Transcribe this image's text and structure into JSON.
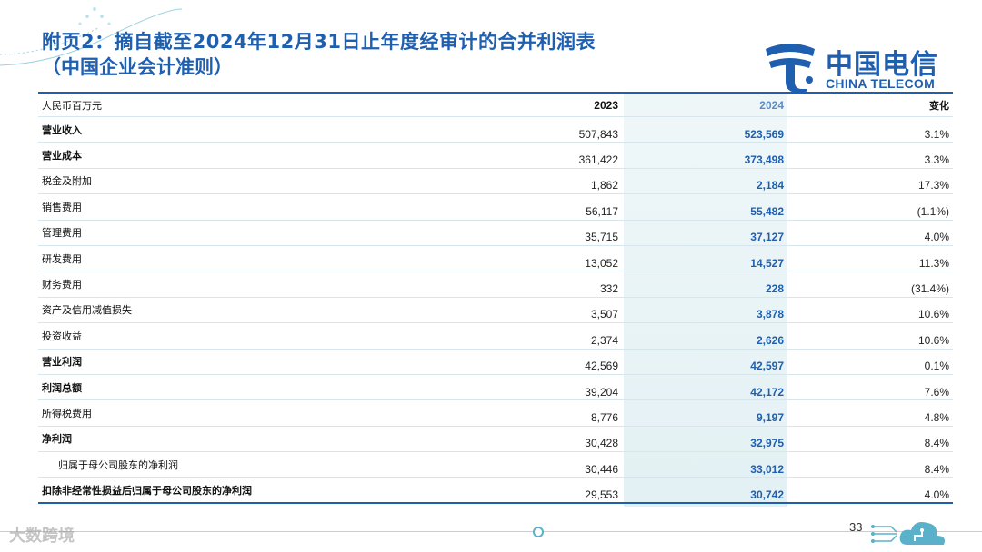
{
  "title_line1": "附页2：摘自截至2024年12月31日止年度经审计的合并利润表",
  "title_line2": "（中国企业会计准则）",
  "logo": {
    "cn": "中国电信",
    "en": "CHINA TELECOM",
    "color": "#1f5fb0"
  },
  "table": {
    "headers": {
      "label": "人民币百万元",
      "y2023": "2023",
      "y2024": "2024",
      "change": "变化"
    },
    "rows": [
      {
        "label": "营业收入",
        "y2023": "507,843",
        "y2024": "523,569",
        "change": "3.1%"
      },
      {
        "label": "营业成本",
        "y2023": "361,422",
        "y2024": "373,498",
        "change": "3.3%"
      },
      {
        "label": "税金及附加",
        "y2023": "1,862",
        "y2024": "2,184",
        "change": "17.3%"
      },
      {
        "label": "销售费用",
        "y2023": "56,117",
        "y2024": "55,482",
        "change": "(1.1%)"
      },
      {
        "label": "管理费用",
        "y2023": "35,715",
        "y2024": "37,127",
        "change": "4.0%"
      },
      {
        "label": "研发费用",
        "y2023": "13,052",
        "y2024": "14,527",
        "change": "11.3%"
      },
      {
        "label": "财务费用",
        "y2023": "332",
        "y2024": "228",
        "change": "(31.4%)"
      },
      {
        "label": "资产及信用减值损失",
        "y2023": "3,507",
        "y2024": "3,878",
        "change": "10.6%"
      },
      {
        "label": "投资收益",
        "y2023": "2,374",
        "y2024": "2,626",
        "change": "10.6%"
      },
      {
        "label": "营业利润",
        "y2023": "42,569",
        "y2024": "42,597",
        "change": "0.1%"
      },
      {
        "label": "利润总额",
        "y2023": "39,204",
        "y2024": "42,172",
        "change": "7.6%"
      },
      {
        "label": "所得税费用",
        "y2023": "8,776",
        "y2024": "9,197",
        "change": "4.8%"
      },
      {
        "label": "净利润",
        "y2023": "30,428",
        "y2024": "32,975",
        "change": "8.4%"
      },
      {
        "label": "归属于母公司股东的净利润",
        "y2023": "30,446",
        "y2024": "33,012",
        "change": "8.4%"
      },
      {
        "label": "扣除非经常性损益后归属于母公司股东的净利润",
        "y2023": "29,553",
        "y2024": "30,742",
        "change": "4.0%"
      }
    ]
  },
  "page_number": "33",
  "watermark": "大数跨境",
  "colors": {
    "accent": "#1f5fb0",
    "highlight_2024": "#1f5fb0",
    "rule": "#d6e6ec"
  }
}
